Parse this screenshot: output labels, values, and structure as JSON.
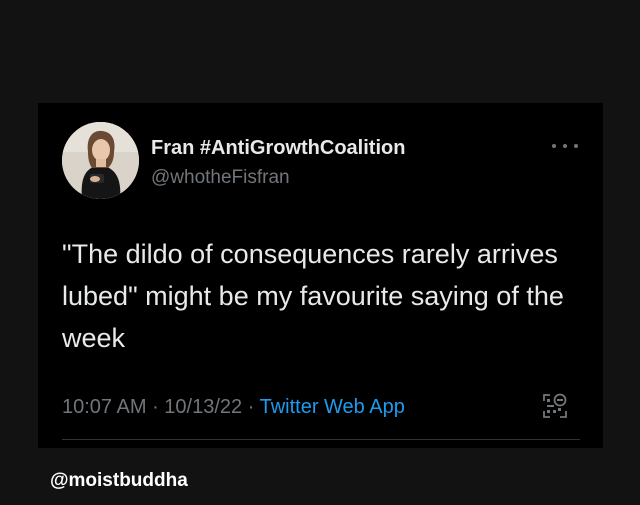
{
  "tweet": {
    "author": {
      "display_name": "Fran #AntiGrowthCoalition",
      "handle": "@whotheFisfran"
    },
    "text": "\"The dildo of consequences rarely arrives lubed\" might be my favourite saying of the week",
    "meta": {
      "time": "10:07 AM",
      "separator": " · ",
      "date": "10/13/22",
      "source": "Twitter Web App"
    },
    "icons": {
      "more": "more-options-icon",
      "qr": "qr-code-icon"
    }
  },
  "watermark": "@moistbuddha",
  "colors": {
    "background": "#121212",
    "card": "#000000",
    "text": "#e7e9ea",
    "secondary": "#71767b",
    "link": "#1d9bf0"
  }
}
